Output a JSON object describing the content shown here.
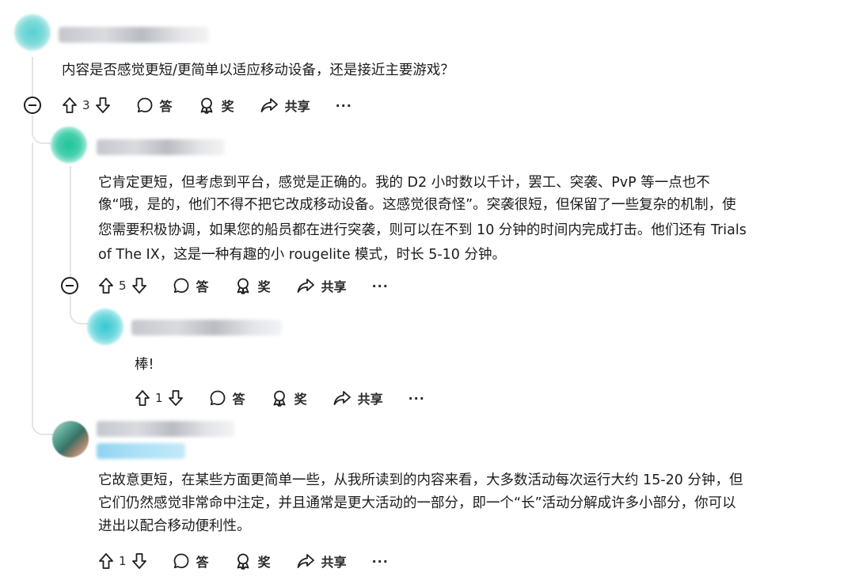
{
  "comments": [
    {
      "id": "c1",
      "body": "内容是否感觉更短/更简单以适应移动设备，还是接近主要游戏？",
      "votes": "3",
      "reply_label": "答",
      "award_label": "奖",
      "share_label": "共享",
      "more_label": "···",
      "avatar_icon": "avatar-teal-blurred"
    },
    {
      "id": "c2",
      "body_lines": [
        "它肯定更短，但考虑到平台，感觉是正确的。我的 D2 小时数以千计，罢工、突袭、PvP 等一点也不",
        "像“哦，是的，他们不得不把它改成移动设备。这感觉很奇怪”。突袭很短，但保留了一些复杂的机制，使",
        "您需要积极协调，如果您的船员都在进行突袭，则可以在不到 10 分钟的时间内完成打击。他们还有 Trials",
        "of The IX，这是一种有趣的小 rougelite 模式，时长 5-10 分钟。"
      ],
      "votes": "5",
      "reply_label": "答",
      "award_label": "奖",
      "share_label": "共享",
      "more_label": "···",
      "avatar_icon": "avatar-green-blurred"
    },
    {
      "id": "c3",
      "body": "棒!",
      "votes": "1",
      "reply_label": "答",
      "award_label": "奖",
      "share_label": "共享",
      "more_label": "···",
      "avatar_icon": "avatar-cyan-blurred"
    },
    {
      "id": "c4",
      "body_lines": [
        "它故意更短，在某些方面更简单一些，从我所读到的内容来看，大多数活动每次运行大约 15-20 分钟，但",
        "它们仍然感觉非常命中注定，并且通常是更大活动的一部分，即一个“长”活动分解成许多小部分，你可以",
        "进出以配合移动便利性。"
      ],
      "votes": "1",
      "reply_label": "答",
      "award_label": "奖",
      "share_label": "共享",
      "more_label": "···",
      "avatar_icon": "avatar-photo-blurred"
    }
  ],
  "colors": {
    "thread_line": "#e3e5e8",
    "text": "#1c1c1c",
    "flair_blur": "#a9dff5"
  }
}
